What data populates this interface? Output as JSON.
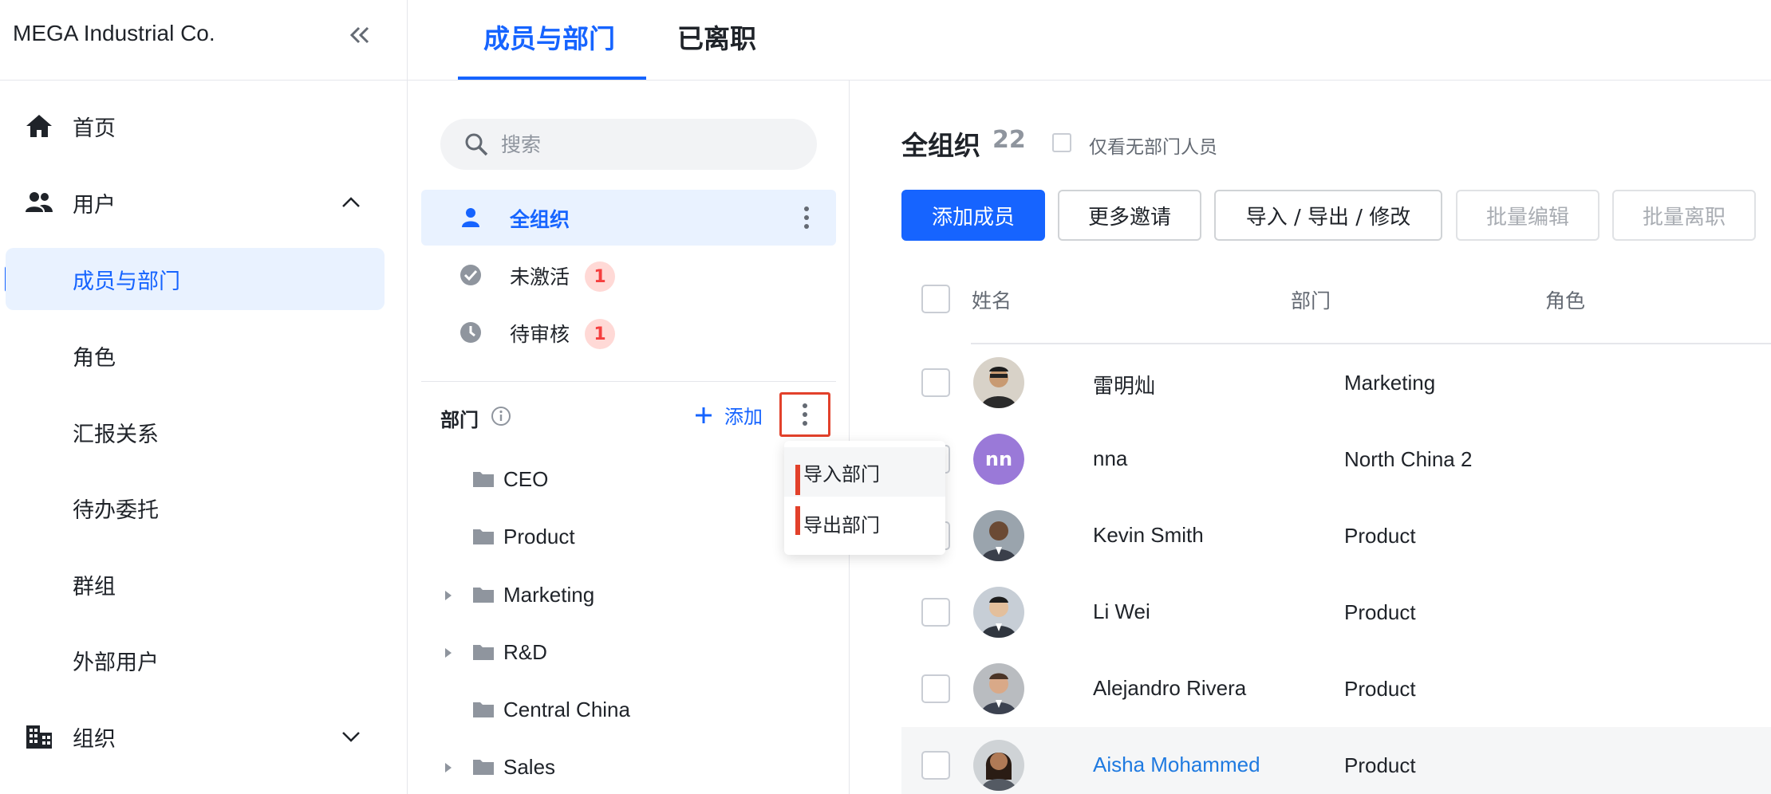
{
  "brand": "MEGA Industrial Co.",
  "sidebar": {
    "items": [
      {
        "label": "首页",
        "icon": "home-icon"
      },
      {
        "label": "用户",
        "icon": "users-icon",
        "expanded": true
      },
      {
        "label": "成员与部门",
        "active": true
      },
      {
        "label": "角色"
      },
      {
        "label": "汇报关系"
      },
      {
        "label": "待办委托"
      },
      {
        "label": "群组"
      },
      {
        "label": "外部用户"
      },
      {
        "label": "组织",
        "icon": "building-icon",
        "expanded": false
      }
    ]
  },
  "tabs": [
    {
      "label": "成员与部门",
      "active": true
    },
    {
      "label": "已离职"
    }
  ],
  "mid": {
    "search_placeholder": "搜索",
    "org_items": [
      {
        "label": "全组织",
        "icon": "person-icon",
        "active": true
      },
      {
        "label": "未激活",
        "icon": "check-circle-icon",
        "badge": "1"
      },
      {
        "label": "待审核",
        "icon": "clock-icon",
        "badge": "1"
      }
    ],
    "dept_title": "部门",
    "add_label": "添加",
    "departments": [
      {
        "label": "CEO",
        "expandable": false
      },
      {
        "label": "Product",
        "expandable": false
      },
      {
        "label": "Marketing",
        "expandable": true
      },
      {
        "label": "R&D",
        "expandable": true
      },
      {
        "label": "Central China",
        "expandable": false
      },
      {
        "label": "Sales",
        "expandable": true
      }
    ],
    "dropdown": [
      "导入部门",
      "导出部门"
    ]
  },
  "main": {
    "title": "全组织",
    "count": "22",
    "filter_label": "仅看无部门人员",
    "buttons": {
      "add_member": "添加成员",
      "more_invite": "更多邀请",
      "import_export": "导入 / 导出 / 修改",
      "batch_edit": "批量编辑",
      "batch_leave": "批量离职"
    },
    "columns": {
      "name": "姓名",
      "dept": "部门",
      "role": "角色"
    },
    "rows": [
      {
        "name": "雷明灿",
        "dept": "Marketing"
      },
      {
        "name": "nna",
        "dept": "North China 2",
        "initials": "nn"
      },
      {
        "name": "Kevin Smith",
        "dept": "Product"
      },
      {
        "name": "Li Wei",
        "dept": "Product"
      },
      {
        "name": "Alejandro Rivera",
        "dept": "Product"
      },
      {
        "name": "Aisha Mohammed",
        "dept": "Product",
        "link": true
      }
    ]
  },
  "colors": {
    "accent": "#1664ff",
    "highlight": "#e2412b",
    "badge_bg": "#ffd9d6",
    "badge_fg": "#f53f3f"
  }
}
